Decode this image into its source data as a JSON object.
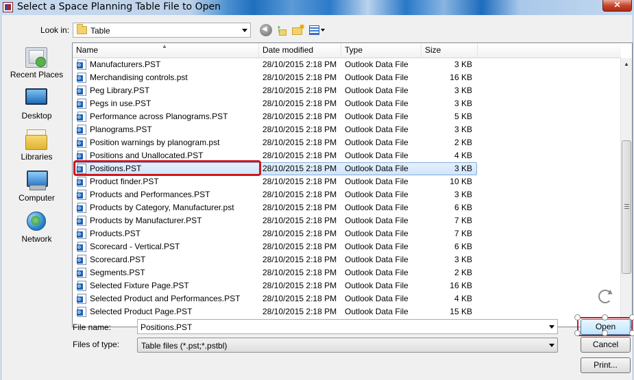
{
  "window": {
    "title": "Select a Space Planning Table File to Open",
    "close_label": "✕"
  },
  "lookin": {
    "label": "Look in:",
    "value": "Table"
  },
  "places": [
    {
      "id": "recent",
      "label": "Recent Places",
      "icon": "recent-places-icon"
    },
    {
      "id": "desktop",
      "label": "Desktop",
      "icon": "desktop-icon"
    },
    {
      "id": "libraries",
      "label": "Libraries",
      "icon": "libraries-icon"
    },
    {
      "id": "computer",
      "label": "Computer",
      "icon": "computer-icon"
    },
    {
      "id": "network",
      "label": "Network",
      "icon": "network-icon"
    }
  ],
  "columns": {
    "name": "Name",
    "date": "Date modified",
    "type": "Type",
    "size": "Size"
  },
  "files": [
    {
      "name": "Manufacturers.PST",
      "date": "28/10/2015 2:18 PM",
      "type": "Outlook Data File",
      "size": "3 KB"
    },
    {
      "name": "Merchandising controls.pst",
      "date": "28/10/2015 2:18 PM",
      "type": "Outlook Data File",
      "size": "16 KB"
    },
    {
      "name": "Peg Library.PST",
      "date": "28/10/2015 2:18 PM",
      "type": "Outlook Data File",
      "size": "3 KB"
    },
    {
      "name": "Pegs in use.PST",
      "date": "28/10/2015 2:18 PM",
      "type": "Outlook Data File",
      "size": "3 KB"
    },
    {
      "name": "Performance across Planograms.PST",
      "date": "28/10/2015 2:18 PM",
      "type": "Outlook Data File",
      "size": "5 KB"
    },
    {
      "name": "Planograms.PST",
      "date": "28/10/2015 2:18 PM",
      "type": "Outlook Data File",
      "size": "3 KB"
    },
    {
      "name": "Position warnings by planogram.pst",
      "date": "28/10/2015 2:18 PM",
      "type": "Outlook Data File",
      "size": "2 KB"
    },
    {
      "name": "Positions and Unallocated.PST",
      "date": "28/10/2015 2:18 PM",
      "type": "Outlook Data File",
      "size": "4 KB"
    },
    {
      "name": "Positions.PST",
      "date": "28/10/2015 2:18 PM",
      "type": "Outlook Data File",
      "size": "3 KB"
    },
    {
      "name": "Product finder.PST",
      "date": "28/10/2015 2:18 PM",
      "type": "Outlook Data File",
      "size": "10 KB"
    },
    {
      "name": "Products and Performances.PST",
      "date": "28/10/2015 2:18 PM",
      "type": "Outlook Data File",
      "size": "3 KB"
    },
    {
      "name": "Products by Category, Manufacturer.pst",
      "date": "28/10/2015 2:18 PM",
      "type": "Outlook Data File",
      "size": "6 KB"
    },
    {
      "name": "Products by Manufacturer.PST",
      "date": "28/10/2015 2:18 PM",
      "type": "Outlook Data File",
      "size": "7 KB"
    },
    {
      "name": "Products.PST",
      "date": "28/10/2015 2:18 PM",
      "type": "Outlook Data File",
      "size": "7 KB"
    },
    {
      "name": "Scorecard - Vertical.PST",
      "date": "28/10/2015 2:18 PM",
      "type": "Outlook Data File",
      "size": "6 KB"
    },
    {
      "name": "Scorecard.PST",
      "date": "28/10/2015 2:18 PM",
      "type": "Outlook Data File",
      "size": "3 KB"
    },
    {
      "name": "Segments.PST",
      "date": "28/10/2015 2:18 PM",
      "type": "Outlook Data File",
      "size": "2 KB"
    },
    {
      "name": "Selected Fixture Page.PST",
      "date": "28/10/2015 2:18 PM",
      "type": "Outlook Data File",
      "size": "16 KB"
    },
    {
      "name": "Selected Product and Performances.PST",
      "date": "28/10/2015 2:18 PM",
      "type": "Outlook Data File",
      "size": "4 KB"
    },
    {
      "name": "Selected Product Page.PST",
      "date": "28/10/2015 2:18 PM",
      "type": "Outlook Data File",
      "size": "15 KB"
    }
  ],
  "selected_file": "Positions.PST",
  "filename": {
    "label": "File name:",
    "value": "Positions.PST"
  },
  "filetype": {
    "label": "Files of type:",
    "value": "Table files (*.pst;*.pstbl)"
  },
  "buttons": {
    "open": "Open",
    "cancel": "Cancel",
    "print": "Print..."
  },
  "colors": {
    "highlight": "#d0161c",
    "selection": "#cfe5fb"
  }
}
